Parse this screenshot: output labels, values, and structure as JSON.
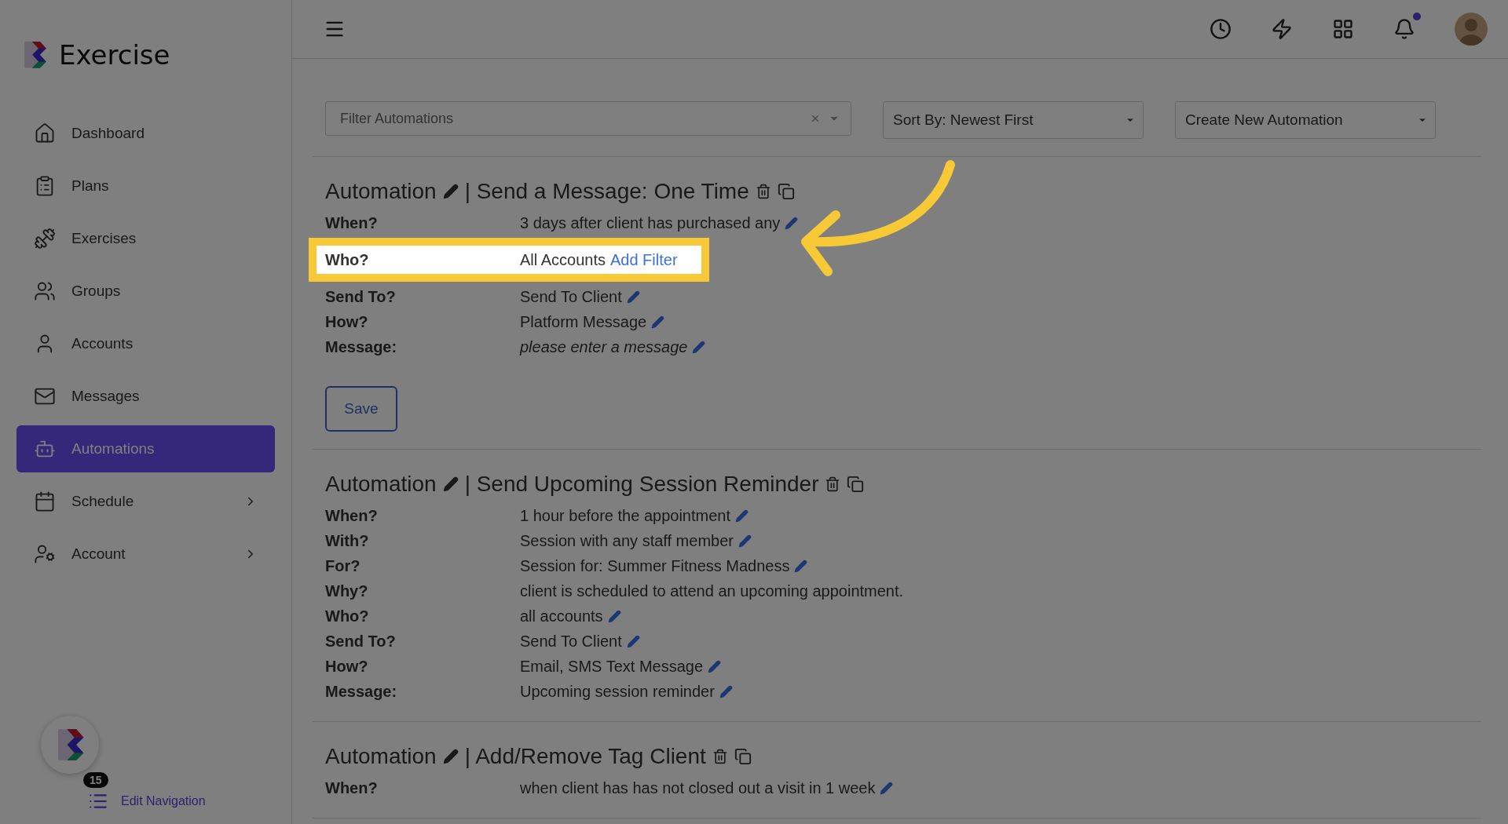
{
  "brand": {
    "name": "Exercise"
  },
  "sidebar": {
    "items": [
      {
        "label": "Dashboard",
        "selected": false,
        "expandable": false
      },
      {
        "label": "Plans",
        "selected": false,
        "expandable": false
      },
      {
        "label": "Exercises",
        "selected": false,
        "expandable": false
      },
      {
        "label": "Groups",
        "selected": false,
        "expandable": false
      },
      {
        "label": "Accounts",
        "selected": false,
        "expandable": false
      },
      {
        "label": "Messages",
        "selected": false,
        "expandable": false
      },
      {
        "label": "Automations",
        "selected": true,
        "expandable": false
      },
      {
        "label": "Schedule",
        "selected": false,
        "expandable": true
      },
      {
        "label": "Account",
        "selected": false,
        "expandable": true
      }
    ],
    "badge": "15",
    "edit_link": "Edit Navigation"
  },
  "top_bar": {
    "notifications_unread": true
  },
  "toolbar": {
    "filter": {
      "placeholder": "Filter Automations"
    },
    "sort": "Sort By: Newest First",
    "create": "Create New Automation"
  },
  "automations": [
    {
      "prefix": "Automation",
      "title": "| Send a Message: One Time",
      "button": "Save",
      "rows": [
        {
          "label": "When?",
          "value": "3 days after client has purchased any",
          "editable": true,
          "italic": false,
          "highlighted": false
        },
        {
          "label": "Who?",
          "value": "All Accounts",
          "link": "Add Filter",
          "editable": false,
          "italic": false,
          "highlighted": true
        },
        {
          "label": "Send To?",
          "value": "Send To Client",
          "editable": true,
          "italic": false,
          "highlighted": false
        },
        {
          "label": "How?",
          "value": "Platform Message",
          "editable": true,
          "italic": false,
          "highlighted": false
        },
        {
          "label": "Message:",
          "value": "please enter a message",
          "editable": true,
          "italic": true,
          "highlighted": false
        }
      ]
    },
    {
      "prefix": "Automation",
      "title": "| Send Upcoming Session Reminder",
      "rows": [
        {
          "label": "When?",
          "value": "1 hour before the appointment",
          "editable": true,
          "italic": false,
          "highlighted": false
        },
        {
          "label": "With?",
          "value": "Session with any staff member",
          "editable": true,
          "italic": false,
          "highlighted": false
        },
        {
          "label": "For?",
          "value": "Session for: Summer Fitness Madness",
          "editable": true,
          "italic": false,
          "highlighted": false
        },
        {
          "label": "Why?",
          "value": "client is scheduled to attend an upcoming appointment.",
          "editable": false,
          "italic": false,
          "highlighted": false
        },
        {
          "label": "Who?",
          "value": "all accounts",
          "editable": true,
          "italic": false,
          "highlighted": false
        },
        {
          "label": "Send To?",
          "value": "Send To Client",
          "editable": true,
          "italic": false,
          "highlighted": false
        },
        {
          "label": "How?",
          "value": "Email, SMS Text Message",
          "editable": true,
          "italic": false,
          "highlighted": false
        },
        {
          "label": "Message:",
          "value": "Upcoming session reminder",
          "editable": true,
          "italic": false,
          "highlighted": false
        }
      ]
    },
    {
      "prefix": "Automation",
      "title": "| Add/Remove Tag Client",
      "rows": [
        {
          "label": "When?",
          "value": "when client has has not closed out a visit in 1 week",
          "editable": true,
          "italic": false,
          "highlighted": false
        }
      ]
    }
  ]
}
